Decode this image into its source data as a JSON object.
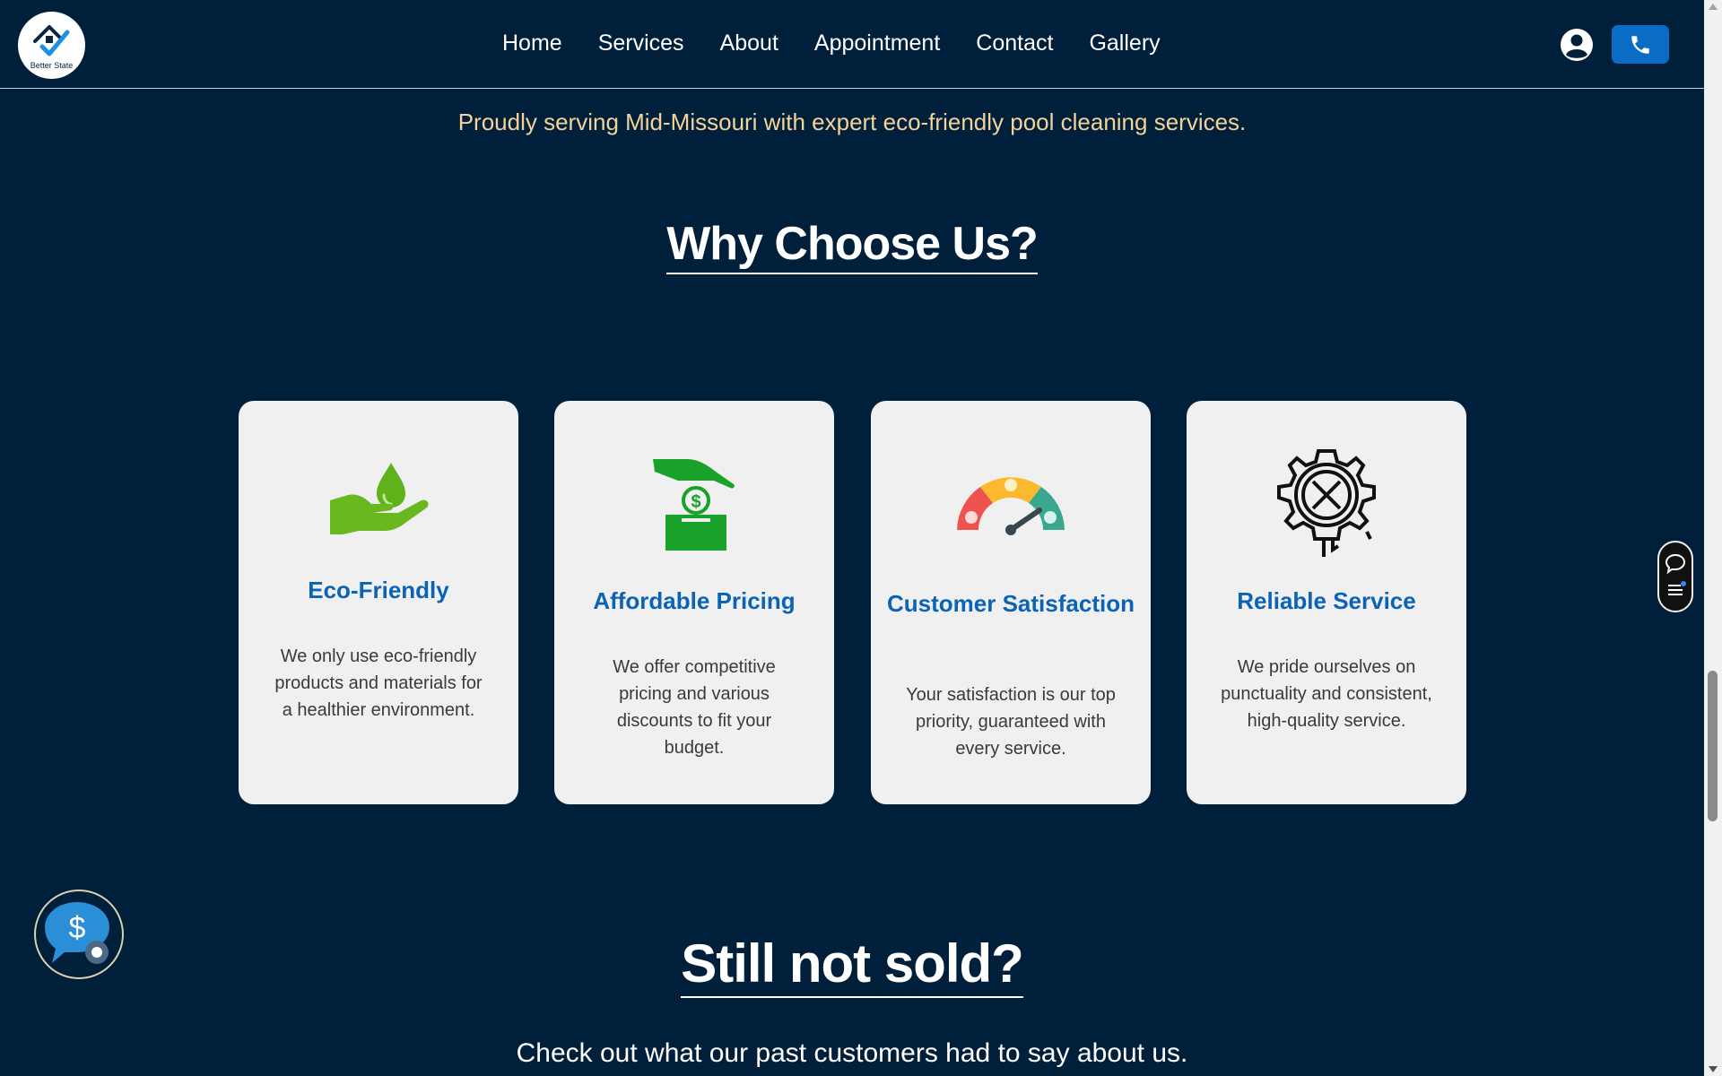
{
  "header": {
    "logo_text": "Better State",
    "nav": [
      "Home",
      "Services",
      "About",
      "Appointment",
      "Contact",
      "Gallery"
    ],
    "icons": [
      "user-icon",
      "phone-icon"
    ]
  },
  "hero": {
    "tagline": "Proudly serving Mid-Missouri with expert eco-friendly pool cleaning services."
  },
  "why_choose": {
    "title": "Why Choose Us?",
    "cards": [
      {
        "icon": "hand-water-drop-icon",
        "title": "Eco-Friendly",
        "text": "We only use eco-friendly products and materials for a healthier environment."
      },
      {
        "icon": "hand-dollar-box-icon",
        "title": "Affordable Pricing",
        "text": "We offer competitive pricing and various discounts to fit your budget."
      },
      {
        "icon": "satisfaction-gauge-icon",
        "title": "Customer Satisfaction",
        "text": "Your satisfaction is our top priority, guaranteed with every service."
      },
      {
        "icon": "gear-tools-icon",
        "title": "Reliable Service",
        "text": "We pride ourselves on punctuality and consistent, high-quality service."
      }
    ]
  },
  "testimonials": {
    "title": "Still not sold?",
    "subtitle": "Check out what our past customers had to say about us."
  },
  "colors": {
    "background": "#001f3a",
    "accent": "#0b63b6",
    "tagline": "#f2d39a",
    "card": "#f0f0f0"
  }
}
